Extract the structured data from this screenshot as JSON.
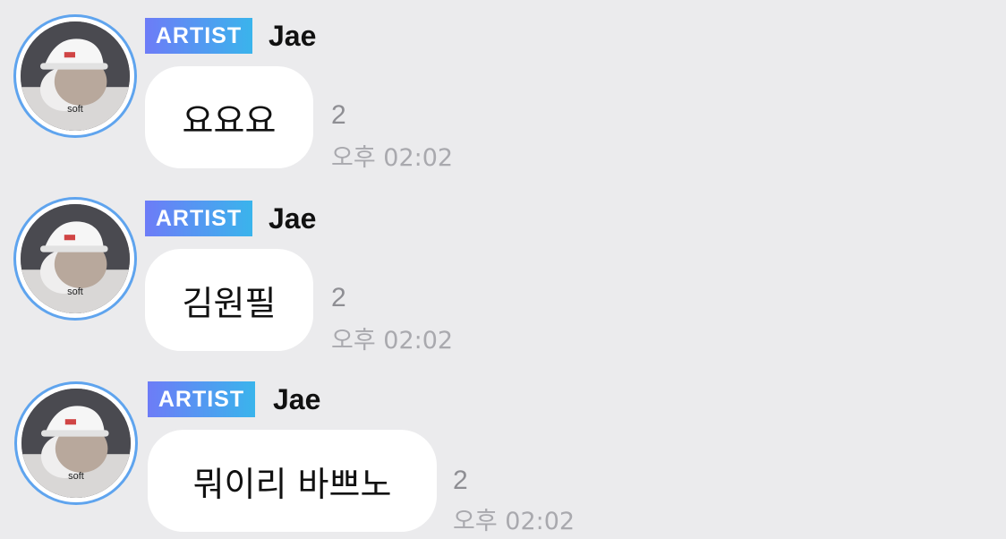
{
  "messages": [
    {
      "badge": "ARTIST",
      "sender": "Jae",
      "avatar_caption": "soft",
      "text": "요요요",
      "unread_count": "2",
      "time": "오후 02:02"
    },
    {
      "badge": "ARTIST",
      "sender": "Jae",
      "avatar_caption": "soft",
      "text": "김원필",
      "unread_count": "2",
      "time": "오후 02:02"
    },
    {
      "badge": "ARTIST",
      "sender": "Jae",
      "avatar_caption": "soft",
      "text": "뭐이리 바쁘노",
      "unread_count": "2",
      "time": "오후 02:02"
    }
  ],
  "colors": {
    "background": "#ebebed",
    "avatar_ring": "#5fa4ee",
    "badge_gradient_start": "#6d7cf7",
    "badge_gradient_end": "#3ab4ec",
    "bubble": "#ffffff",
    "meta_text": "#a9a9ae"
  }
}
